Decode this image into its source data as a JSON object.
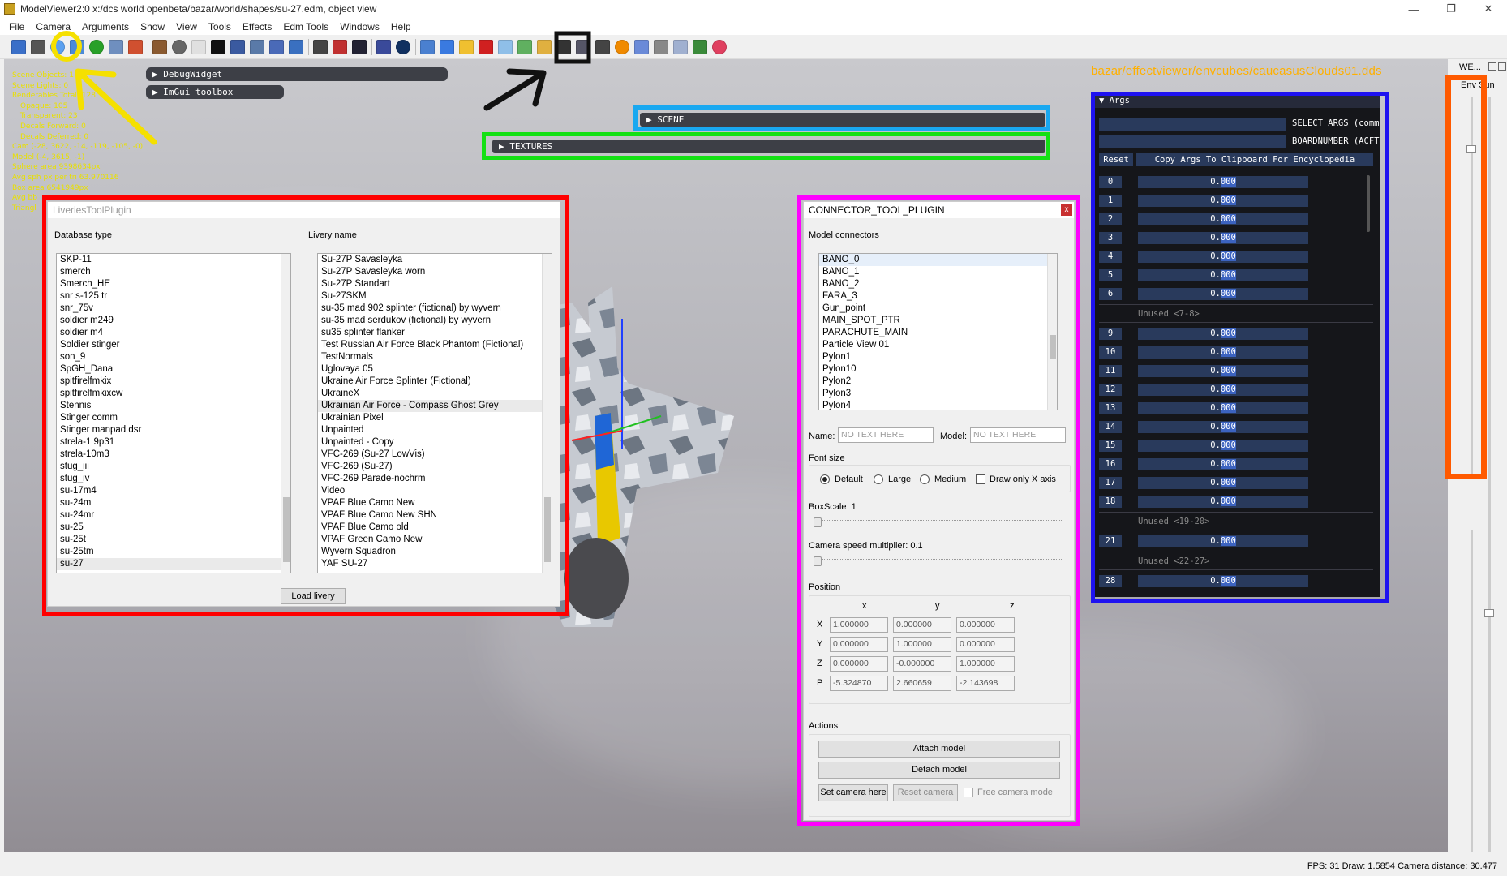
{
  "window": {
    "title": "ModelViewer2:0 x:/dcs world openbeta/bazar/world/shapes/su-27.edm, object view",
    "controls": [
      "—",
      "❐",
      "✕"
    ]
  },
  "menu": [
    "File",
    "Camera",
    "Arguments",
    "Show",
    "View",
    "Tools",
    "Effects",
    "Edm Tools",
    "Windows",
    "Help"
  ],
  "stats": [
    "Scene Objects: 1",
    "Scene Lights: 0",
    "Renderables Total: 128",
    "Opaque: 105",
    "Transparent: 23",
    "Decals Forward: 0",
    "Decals Deferred: 0",
    "Cam (-28, 3622, -14, -119, -105, -0)",
    "Model (-4, 3615, -1)",
    "Sphere area 9398634px",
    "Avg sph px per tri 63.970116",
    "Box area 6541949px",
    "Avg bb",
    "Triangl"
  ],
  "imgui_buttons": {
    "debug": "DebugWidget",
    "toolbox": "ImGui toolbox",
    "scene": "SCENE",
    "textures": "TEXTURES"
  },
  "env_path": "bazar/effectviewer/envcubes/caucasusClouds01.dds",
  "liveries": {
    "title": "LiveriesToolPlugin",
    "db_label": "Database type",
    "livery_label": "Livery name",
    "db_items": [
      "SKP-11",
      "smerch",
      "Smerch_HE",
      "snr s-125 tr",
      "snr_75v",
      "soldier m249",
      "soldier m4",
      "Soldier stinger",
      "son_9",
      "SpGH_Dana",
      "spitfirelfmkix",
      "spitfirelfmkixcw",
      "Stennis",
      "Stinger comm",
      "Stinger manpad dsr",
      "strela-1 9p31",
      "strela-10m3",
      "stug_iii",
      "stug_iv",
      "su-17m4",
      "su-24m",
      "su-24mr",
      "su-25",
      "su-25t",
      "su-25tm",
      "su-27"
    ],
    "livery_items": [
      "Su-27P Savasleyka",
      "Su-27P Savasleyka worn",
      "Su-27P Standart",
      "Su-27SKM",
      "su-35 mad 902 splinter (fictional) by wyvern",
      "su-35 mad serdukov (fictional) by wyvern",
      "su35 splinter flanker",
      "Test Russian Air Force Black Phantom (Fictional)",
      "TestNormals",
      "Uglovaya 05",
      "Ukraine Air Force Splinter (Fictional)",
      "UkraineX",
      "Ukrainian Air Force - Compass Ghost Grey",
      "Ukrainian Pixel",
      "Unpainted",
      "Unpainted - Copy",
      "VFC-269 (Su-27 LowVis)",
      "VFC-269 (Su-27)",
      "VFC-269 Parade-nochrm",
      "Video",
      "VPAF Blue Camo New",
      "VPAF Blue Camo New SHN",
      "VPAF Blue Camo old",
      "VPAF Green Camo New",
      "Wyvern Squadron",
      "YAF SU-27"
    ],
    "load_button": "Load livery"
  },
  "connector": {
    "title": "CONNECTOR_TOOL_PLUGIN",
    "close": "x",
    "connectors_label": "Model connectors",
    "connectors": [
      "BANO_0",
      "BANO_1",
      "BANO_2",
      "FARA_3",
      "Gun_point",
      "MAIN_SPOT_PTR",
      "PARACHUTE_MAIN",
      "Particle View 01",
      "Pylon1",
      "Pylon10",
      "Pylon2",
      "Pylon3",
      "Pylon4"
    ],
    "name_label": "Name:",
    "name_placeholder": "NO TEXT HERE",
    "model_label": "Model:",
    "model_placeholder": "NO TEXT HERE",
    "font_size_label": "Font size",
    "font_options": [
      "Default",
      "Large",
      "Medium"
    ],
    "font_selected": "Default",
    "draw_x_label": "Draw only X axis",
    "boxscale_label": "BoxScale",
    "boxscale_value": "1",
    "camspeed_label": "Camera speed multiplier: 0.1",
    "position_label": "Position",
    "axes": [
      "x",
      "y",
      "z"
    ],
    "rows": [
      {
        "label": "X",
        "values": [
          "1.000000",
          "0.000000",
          "0.000000"
        ]
      },
      {
        "label": "Y",
        "values": [
          "0.000000",
          "1.000000",
          "0.000000"
        ]
      },
      {
        "label": "Z",
        "values": [
          "0.000000",
          "-0.000000",
          "1.000000"
        ]
      },
      {
        "label": "P",
        "values": [
          "-5.324870",
          "2.660659",
          "-2.143698"
        ]
      }
    ],
    "actions_label": "Actions",
    "attach": "Attach model",
    "detach": "Detach model",
    "set_camera": "Set camera here",
    "reset_camera": "Reset camera",
    "free_camera": "Free camera mode"
  },
  "args": {
    "title": "▼ Args",
    "select_label": "SELECT ARGS (comm",
    "board_label": "BOARDNUMBER (ACFT",
    "reset": "Reset",
    "copy": "Copy Args To Clipboard For Encyclopedia",
    "value": "0.000",
    "rows": [
      "0",
      "1",
      "2",
      "3",
      "4",
      "5",
      "6",
      "unused:Unused <7-8>",
      "9",
      "10",
      "11",
      "12",
      "13",
      "14",
      "15",
      "16",
      "17",
      "18",
      "unused:Unused <19-20>",
      "21",
      "unused:Unused <22-27>",
      "28"
    ]
  },
  "side": {
    "tab1": "WE...",
    "env": "Env",
    "sun": "Sun"
  },
  "status": "FPS: 31  Draw: 1.5854  Camera distance: 30.477",
  "annotation_colors": {
    "yellow": "#f5e000",
    "black": "#111111",
    "cyan": "#19a8f0",
    "green": "#14e014",
    "red": "#ff0000",
    "magenta": "#ff00ff",
    "blue": "#1e12f0",
    "orange": "#ff5a00"
  }
}
